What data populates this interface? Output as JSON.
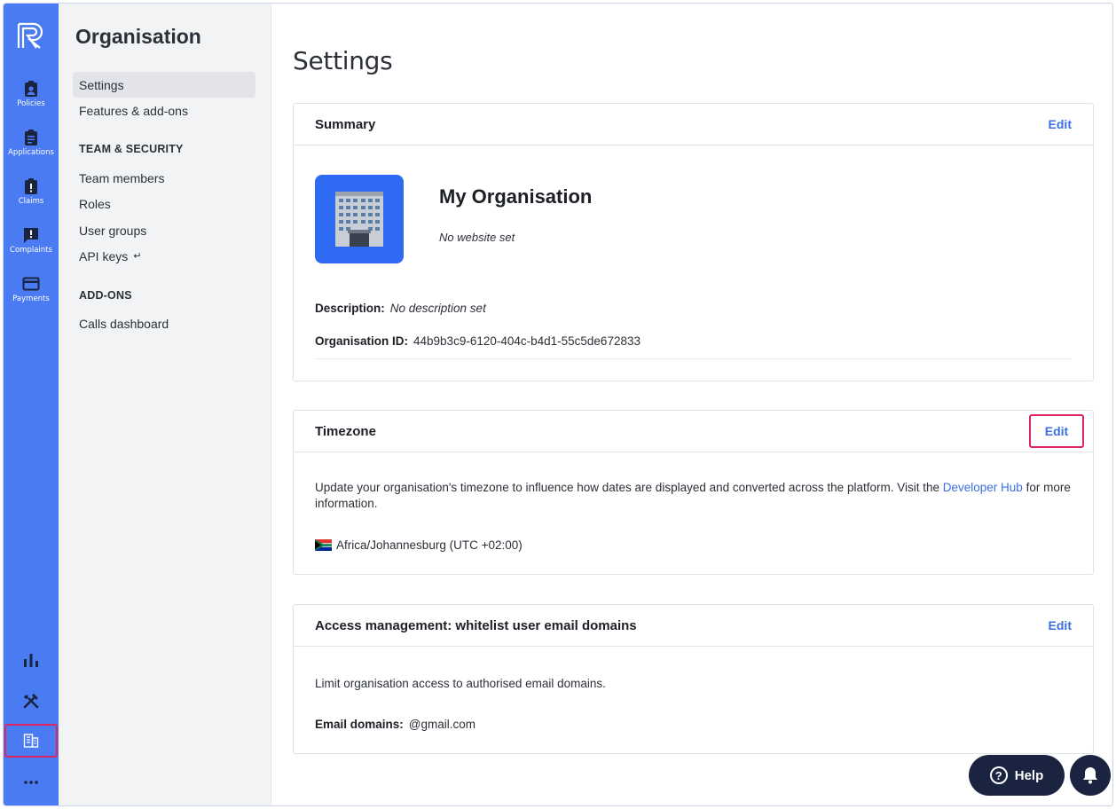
{
  "rail": {
    "items": [
      {
        "label": "Policies",
        "icon": "clipboard-person-icon"
      },
      {
        "label": "Applications",
        "icon": "clipboard-list-icon"
      },
      {
        "label": "Claims",
        "icon": "clipboard-alert-icon"
      },
      {
        "label": "Complaints",
        "icon": "chat-alert-icon"
      },
      {
        "label": "Payments",
        "icon": "credit-card-icon"
      }
    ],
    "bottom_icons": [
      "bar-chart-icon",
      "tools-icon",
      "building-icon",
      "more-icon"
    ]
  },
  "sidebar": {
    "title": "Organisation",
    "links": [
      "Settings",
      "Features & add-ons"
    ],
    "team_heading": "TEAM & SECURITY",
    "team_links": [
      "Team members",
      "Roles",
      "User groups",
      "API keys"
    ],
    "addons_heading": "ADD-ONS",
    "addons_links": [
      "Calls dashboard"
    ]
  },
  "main": {
    "title": "Settings",
    "summary": {
      "title": "Summary",
      "edit": "Edit",
      "org_name": "My Organisation",
      "website": "No website set",
      "description_label": "Description:",
      "description_value": "No description set",
      "org_id_label": "Organisation ID:",
      "org_id_value": "44b9b3c9-6120-404c-b4d1-55c5de672833"
    },
    "timezone": {
      "title": "Timezone",
      "edit": "Edit",
      "text_before": "Update your organisation's timezone to influence how dates are displayed and converted across the platform. Visit the ",
      "link": "Developer Hub",
      "text_after": " for more information.",
      "value": "Africa/Johannesburg (UTC +02:00)"
    },
    "access": {
      "title": "Access management: whitelist user email domains",
      "edit": "Edit",
      "text": "Limit organisation access to authorised email domains.",
      "domains_label": "Email domains:",
      "domains_value": "@gmail.com"
    }
  },
  "help": {
    "label": "Help"
  },
  "colors": {
    "rail": "#4a7bf2",
    "accent": "#3b6fe0",
    "highlight": "#e0245e",
    "dark": "#1a2340"
  }
}
